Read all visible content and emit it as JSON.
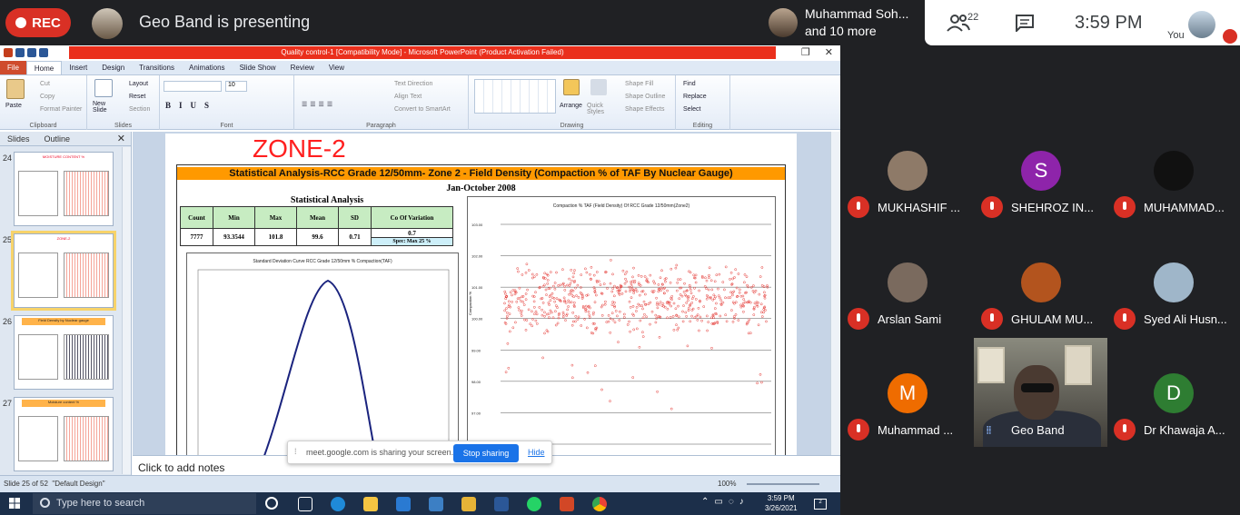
{
  "meet": {
    "rec_label": "REC",
    "presenting": "Geo Band is presenting",
    "presenter_name": "Muhammad Soh...",
    "presenter_more": "and 10 more",
    "people_count": "22",
    "clock": "3:59 PM",
    "you_label": "You",
    "colors": {
      "rec": "#d93025",
      "bg": "#202124",
      "accent": "#1a73e8"
    }
  },
  "ppt": {
    "window_title": "Quality control-1 [Compatibility Mode] - Microsoft PowerPoint (Product Activation Failed)",
    "tabs": [
      "File",
      "Home",
      "Insert",
      "Design",
      "Transitions",
      "Animations",
      "Slide Show",
      "Review",
      "View"
    ],
    "ribbon": {
      "clipboard": {
        "paste": "Paste",
        "cut": "Cut",
        "copy": "Copy",
        "format_painter": "Format Painter",
        "label": "Clipboard"
      },
      "slides": {
        "new_slide": "New Slide",
        "layout": "Layout",
        "reset": "Reset",
        "section": "Section",
        "label": "Slides"
      },
      "font": {
        "size": "10",
        "label": "Font"
      },
      "paragraph": {
        "text_direction": "Text Direction",
        "align_text": "Align Text",
        "convert_smartart": "Convert to SmartArt",
        "label": "Paragraph"
      },
      "drawing": {
        "arrange": "Arrange",
        "quick_styles": "Quick Styles",
        "shape_fill": "Shape Fill",
        "shape_outline": "Shape Outline",
        "shape_effects": "Shape Effects",
        "label": "Drawing"
      },
      "editing": {
        "find": "Find",
        "replace": "Replace",
        "select": "Select",
        "label": "Editing"
      }
    },
    "panel_tabs": {
      "slides": "Slides",
      "outline": "Outline"
    },
    "thumbnails": [
      {
        "num": "24",
        "title": "MOISTURE CONTENT %"
      },
      {
        "num": "25",
        "title": "ZONE-2"
      },
      {
        "num": "26",
        "title": "Field Density by Nuclear gauge"
      },
      {
        "num": "27",
        "title": "Moisture content %"
      }
    ],
    "slide": {
      "zone_title": "ZONE-2",
      "banner": "Statistical Analysis-RCC Grade 12/50mm- Zone 2 - Field Density (Compaction % of TAF By Nuclear Gauge)",
      "date_range": "Jan-October 2008",
      "stat_heading": "Statistical Analysis",
      "table_headers": [
        "Count",
        "Min",
        "Max",
        "Mean",
        "SD",
        "Co Of Variation"
      ],
      "table_values": [
        "7777",
        "93.3544",
        "101.8",
        "99.6",
        "0.71",
        "0.7"
      ],
      "spec": "Spec: Max 25 %",
      "left_chart_title": "Standard Deviation Curve RCC Grade 12/50mm % Compaction(TAF)",
      "right_chart_title": "Compaction % TAF (Field Density) Of RCC Grade 12/50mm(Zone2)",
      "right_chart_ylabel": "Compaction %",
      "right_chart_ticks": [
        "103.00",
        "102.00",
        "101.00",
        "100.00",
        "99.00",
        "98.00",
        "97.00",
        "96.00"
      ]
    },
    "notes_placeholder": "Click to add notes",
    "status": {
      "slide_info": "Slide 25 of 52",
      "theme": "\"Default Design\"",
      "zoom": "100%"
    },
    "share_bar": {
      "text": "meet.google.com is sharing your screen.",
      "stop": "Stop sharing",
      "hide": "Hide"
    }
  },
  "participants": [
    {
      "name": "MUKHASHIF ...",
      "initial": "",
      "color": "#8e7a68"
    },
    {
      "name": "SHEHROZ IN...",
      "initial": "S",
      "color": "#8e24aa"
    },
    {
      "name": "MUHAMMAD...",
      "initial": "",
      "color": "#111111"
    },
    {
      "name": "Arslan Sami",
      "initial": "",
      "color": "#7a6a5e"
    },
    {
      "name": "GHULAM MU...",
      "initial": "",
      "color": "#b3541e"
    },
    {
      "name": "Syed Ali Husn...",
      "initial": "",
      "color": "#9fb6c9"
    },
    {
      "name": "Muhammad ...",
      "initial": "M",
      "color": "#ef6c00"
    },
    {
      "name": "Geo Band",
      "initial": "",
      "color": "#555555"
    },
    {
      "name": "Dr Khawaja A...",
      "initial": "D",
      "color": "#2e7d32"
    }
  ],
  "taskbar": {
    "search_placeholder": "Type here to search",
    "time": "3:59 PM",
    "date": "3/26/2021",
    "notifications": "2"
  }
}
